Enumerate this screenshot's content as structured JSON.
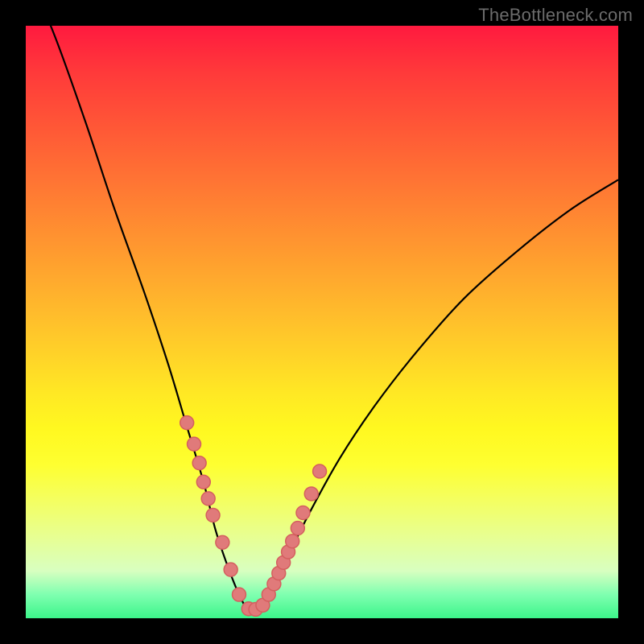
{
  "watermark": "TheBottleneck.com",
  "colors": {
    "dot_fill": "#e07a7a",
    "dot_stroke": "#d45f5f",
    "curve": "#000000"
  },
  "chart_data": {
    "type": "line",
    "title": "",
    "xlabel": "",
    "ylabel": "",
    "xlim": [
      0,
      100
    ],
    "ylim": [
      0,
      100
    ],
    "series": [
      {
        "name": "bottleneck-curve",
        "x": [
          0,
          5,
          10,
          15,
          20,
          24,
          27,
          30,
          32,
          34,
          36,
          37.5,
          39,
          41,
          44,
          48,
          53,
          59,
          66,
          74,
          83,
          92,
          100
        ],
        "y": [
          110,
          98,
          84,
          69,
          55,
          43,
          33,
          23,
          15,
          9,
          4,
          1.5,
          1.5,
          4,
          10,
          18,
          27,
          36,
          45,
          54,
          62,
          69,
          74
        ]
      }
    ],
    "markers": {
      "name": "highlight-dots",
      "x": [
        27.2,
        28.4,
        29.3,
        30.0,
        30.8,
        31.6,
        33.2,
        34.6,
        36.0,
        37.6,
        38.8,
        40.0,
        41.0,
        41.9,
        42.7,
        43.5,
        44.3,
        45.0,
        45.9,
        46.8,
        48.2,
        49.6
      ],
      "y": [
        33.0,
        29.4,
        26.2,
        23.0,
        20.2,
        17.4,
        12.8,
        8.2,
        4.0,
        1.6,
        1.5,
        2.2,
        4.0,
        5.8,
        7.6,
        9.4,
        11.2,
        13.0,
        15.2,
        17.8,
        21.0,
        24.8
      ]
    }
  }
}
